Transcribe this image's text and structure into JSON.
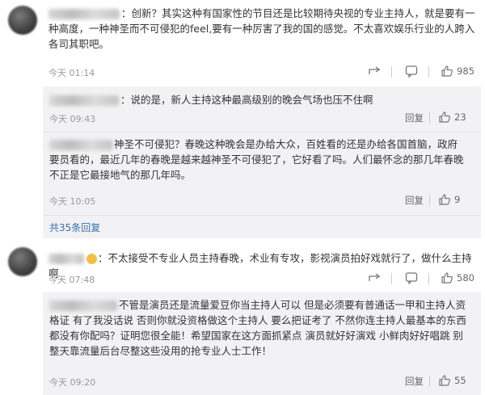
{
  "comments": [
    {
      "text_lines": [
        "：创新？其实这种有国家性的节目还是比较期待央视的专业主持人，就是要有一",
        "种高度，一种神圣而不可侵犯的feel,要有一种厉害了我的国的感觉。不太喜欢娱乐行业的人跨入",
        "各司其职吧。"
      ],
      "time": "今天 01:14",
      "likes": "985",
      "replies": [
        {
          "text_lines": [
            "：说的是，新人主持这种最高级别的晚会气场也压不住啊"
          ],
          "time": "今天 09:43",
          "reply_label": "回复",
          "likes": "23"
        },
        {
          "text_lines": [
            "神圣不可侵犯？春晚这种晚会是办给大众，百姓看的还是办给各国首脑，政府",
            "要员看的，最近几年的春晚是越来越神圣不可侵犯了，它好看了吗。人们最怀念的那几年春晚",
            "不正是它最接地气的那几年吗。"
          ],
          "time": "今天 10:05",
          "reply_label": "回复",
          "likes": "9"
        }
      ],
      "more_replies": "共35条回复"
    },
    {
      "text_lines": [
        "：不太接受不专业人员主持春晚，术业有专攻，影视演员拍好戏就行了，做什么主持啊"
      ],
      "time": "今天 07:48",
      "likes": "580",
      "replies": [
        {
          "text_lines": [
            "不管是演员还是流量爱豆你当主持人可以 但是必须要有普通话一甲和主持人资",
            "格证 有了我没话说 否则你就没资格做这个主持人 要么把证考了 不然你连主持人最基本的东西",
            "都没有你配吗？证明您很全能！希望国家在这方面抓紧点 演员就好好演戏 小鲜肉好好唱跳 别",
            "整天靠流量后台尽整这些没用的抢专业人士工作！"
          ],
          "time": "今天 09:20",
          "reply_label": "回复",
          "likes": "55"
        }
      ]
    }
  ],
  "labels": {
    "reply": "回复"
  },
  "icons": {
    "share": "share-icon",
    "comment": "comment-icon",
    "like": "thumbs-up-icon"
  }
}
